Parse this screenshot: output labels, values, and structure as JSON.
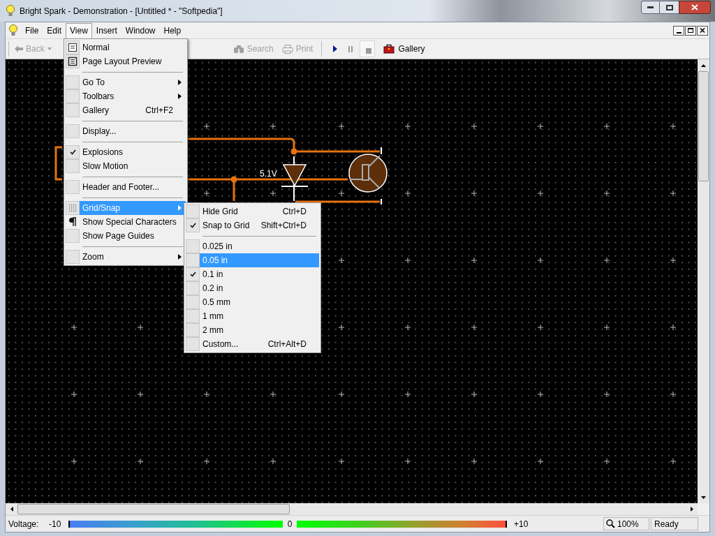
{
  "window": {
    "title": "Bright Spark - Demonstration - [Untitled * - \"Softpedia\"]"
  },
  "menubar": [
    {
      "label": "File",
      "selected": false
    },
    {
      "label": "Edit",
      "selected": false
    },
    {
      "label": "View",
      "selected": true
    },
    {
      "label": "Insert",
      "selected": false
    },
    {
      "label": "Window",
      "selected": false
    },
    {
      "label": "Help",
      "selected": false
    }
  ],
  "toolbar": {
    "back": {
      "label": "Back",
      "disabled": true
    },
    "search": {
      "label": "Search",
      "disabled": true
    },
    "print": {
      "label": "Print",
      "disabled": true
    },
    "gallery": {
      "label": "Gallery"
    }
  },
  "view_menu": [
    {
      "kind": "page",
      "label": "Normal",
      "checked": false,
      "selected": false
    },
    {
      "kind": "layout",
      "label": "Page Layout Preview",
      "checked": false,
      "selected": false
    },
    {
      "kind": "separator"
    },
    {
      "kind": "plain",
      "label": "Go To",
      "checked": false,
      "selected": false,
      "submenu": true
    },
    {
      "kind": "plain",
      "label": "Toolbars",
      "checked": false,
      "selected": false,
      "submenu": true
    },
    {
      "kind": "plain",
      "label": "Gallery",
      "checked": false,
      "selected": false,
      "shortcut": "Ctrl+F2"
    },
    {
      "kind": "separator"
    },
    {
      "kind": "plain",
      "label": "Display...",
      "checked": false,
      "selected": false
    },
    {
      "kind": "separator"
    },
    {
      "kind": "plain",
      "label": "Explosions",
      "checked": true,
      "selected": false
    },
    {
      "kind": "plain",
      "label": "Slow Motion",
      "checked": false,
      "selected": false
    },
    {
      "kind": "separator"
    },
    {
      "kind": "plain",
      "label": "Header and Footer...",
      "checked": false,
      "selected": false
    },
    {
      "kind": "separator"
    },
    {
      "kind": "grid",
      "label": "Grid/Snap",
      "checked": false,
      "selected": true,
      "submenu": true
    },
    {
      "kind": "pilcrow",
      "label": "Show Special Characters",
      "checked": false,
      "selected": false
    },
    {
      "kind": "plain",
      "label": "Show Page Guides",
      "checked": false,
      "selected": false
    },
    {
      "kind": "separator"
    },
    {
      "kind": "plain",
      "label": "Zoom",
      "checked": false,
      "selected": false,
      "submenu": true
    }
  ],
  "grid_menu": [
    {
      "kind": "plain",
      "label": "Hide Grid",
      "checked": false,
      "selected": false,
      "shortcut": "Ctrl+D"
    },
    {
      "kind": "plain",
      "label": "Snap to Grid",
      "checked": true,
      "selected": false,
      "shortcut": "Shift+Ctrl+D"
    },
    {
      "kind": "separator"
    },
    {
      "kind": "plain",
      "label": "0.025 in",
      "checked": false,
      "selected": false
    },
    {
      "kind": "plain",
      "label": "0.05 in",
      "checked": false,
      "selected": true
    },
    {
      "kind": "plain",
      "label": "0.1 in",
      "checked": true,
      "selected": false
    },
    {
      "kind": "plain",
      "label": "0.2 in",
      "checked": false,
      "selected": false
    },
    {
      "kind": "plain",
      "label": "0.5 mm",
      "checked": false,
      "selected": false
    },
    {
      "kind": "plain",
      "label": "1 mm",
      "checked": false,
      "selected": false
    },
    {
      "kind": "plain",
      "label": "2 mm",
      "checked": false,
      "selected": false
    },
    {
      "kind": "plain",
      "label": "Custom...",
      "checked": false,
      "selected": false,
      "shortcut": "Ctrl+Alt+D"
    }
  ],
  "canvas": {
    "zener_label": "5.1V"
  },
  "status_bar": {
    "voltage_label": "Voltage:",
    "min": "-10",
    "mid": "0",
    "max": "+10",
    "zoom": "100%",
    "status": "Ready"
  }
}
